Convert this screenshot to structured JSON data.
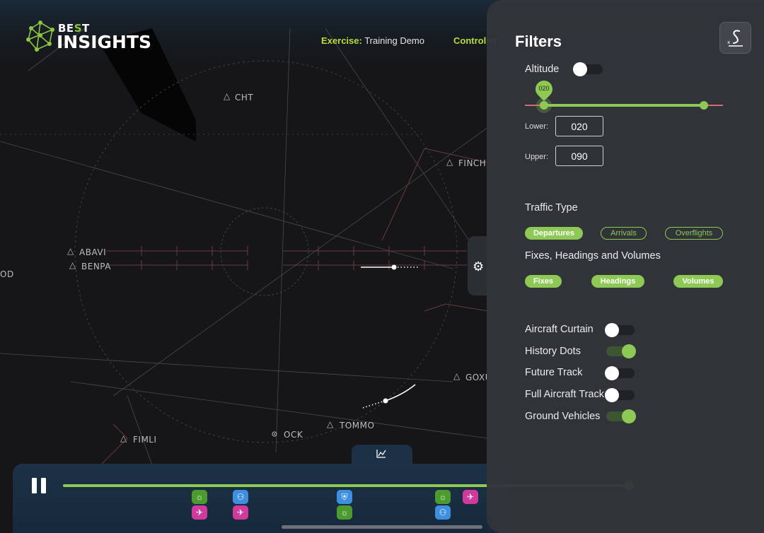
{
  "brand": {
    "line1_a": "BE",
    "line1_s": "S",
    "line1_b": "T",
    "line2": "INSIGHTS"
  },
  "header": {
    "exercise_key": "Exercise:",
    "exercise_val": "Training Demo",
    "controller_key": "Controller"
  },
  "fixes": [
    "CHT",
    "FINCH",
    "ABAVI",
    "BENPA",
    "OD",
    "GOXU",
    "TOMMO",
    "OCK",
    "FIMLI"
  ],
  "filters": {
    "title": "Filters",
    "altitude": {
      "label": "Altitude",
      "enabled": false,
      "bubble": "020",
      "lower_label": "Lower:",
      "lower": "020",
      "upper_label": "Upper:",
      "upper": "090",
      "range_lower": 0.1,
      "range_upper": 0.9
    },
    "traffic_type": {
      "label": "Traffic Type",
      "chips": [
        {
          "label": "Departures",
          "on": true
        },
        {
          "label": "Arrivals",
          "on": false
        },
        {
          "label": "Overflights",
          "on": false
        }
      ]
    },
    "fixes_headings": {
      "label": "Fixes, Headings and Volumes",
      "chips": [
        {
          "label": "Fixes",
          "on": true
        },
        {
          "label": "Headings",
          "on": true
        },
        {
          "label": "Volumes",
          "on": true
        }
      ]
    },
    "toggles": [
      {
        "label": "Aircraft Curtain",
        "on": false
      },
      {
        "label": "History Dots",
        "on": true
      },
      {
        "label": "Future Track",
        "on": false
      },
      {
        "label": "Full Aircraft Track",
        "on": false
      },
      {
        "label": "Ground Vehicles",
        "on": true
      }
    ]
  },
  "timeline": {
    "playing": true,
    "progress": 0.95,
    "events": [
      {
        "icon": "weather-icon",
        "color": "green"
      },
      {
        "icon": "plane-icon",
        "color": "pink"
      },
      {
        "icon": "person-icon",
        "color": "blue"
      },
      {
        "icon": "plane-icon",
        "color": "pink"
      },
      {
        "icon": "shield-icon",
        "color": "blue"
      },
      {
        "icon": "weather-icon",
        "color": "green"
      },
      {
        "icon": "weather-icon",
        "color": "green"
      },
      {
        "icon": "person-icon",
        "color": "blue"
      },
      {
        "icon": "plane-icon",
        "color": "pink"
      }
    ]
  },
  "colors": {
    "accent": "#8ec956",
    "panel": "#32353a",
    "timeline": "#1d3146",
    "event_pink": "#d03a9c",
    "event_blue": "#3f8fe0",
    "event_green": "#4c9b2f"
  }
}
